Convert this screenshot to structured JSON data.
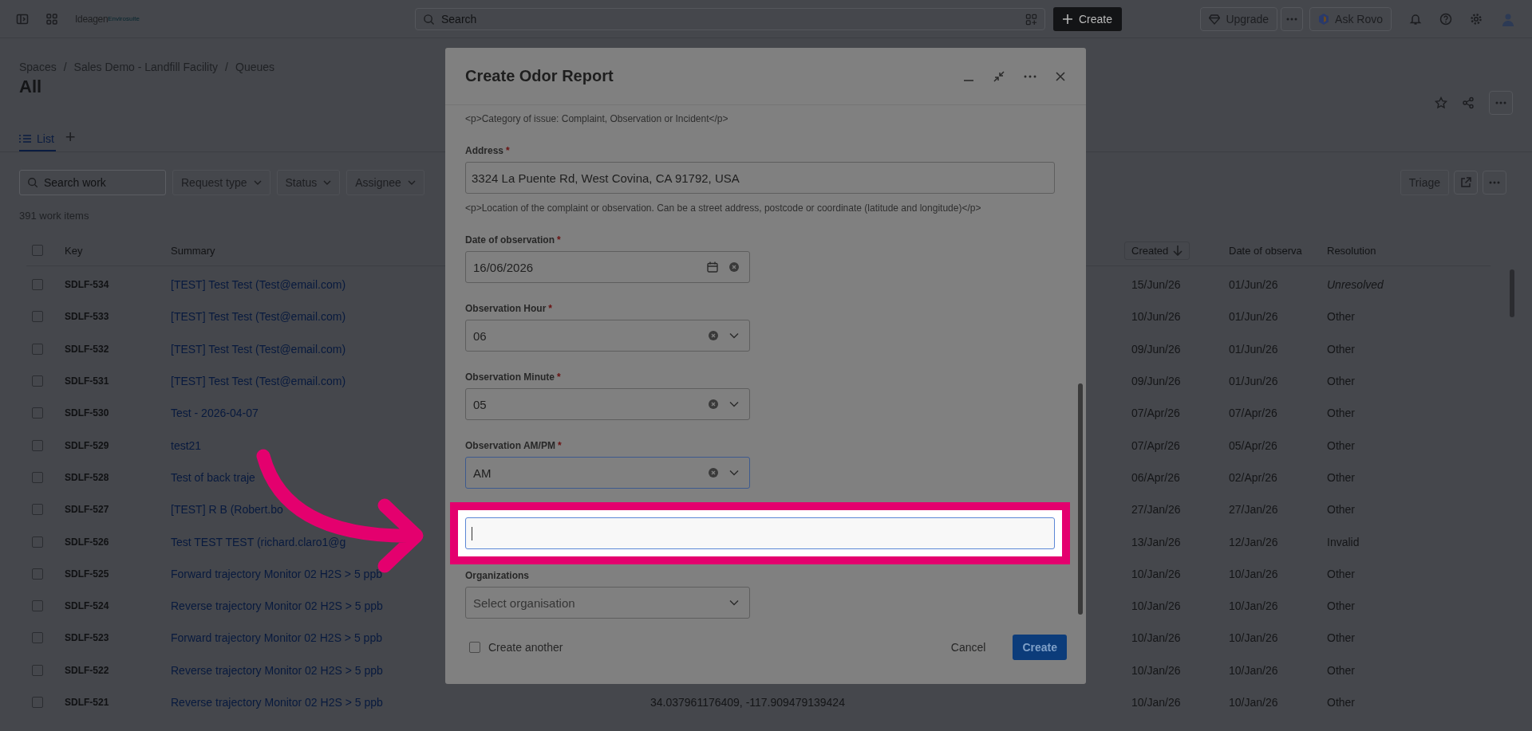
{
  "top_bar": {
    "logo": {
      "name": "Ideagen",
      "sub": "Envirosuite"
    },
    "search": {
      "placeholder": "Search"
    },
    "create_label": "Create",
    "upgrade_label": "Upgrade",
    "rovo_label": "Ask Rovo"
  },
  "breadcrumbs": [
    "Spaces",
    "Sales Demo - Landfill Facility",
    "Queues"
  ],
  "breadcrumb_separator": "/",
  "page_title": "All",
  "tabs": [
    {
      "label": "List",
      "selected": true
    }
  ],
  "add_tab": "+",
  "filters": {
    "search": {
      "placeholder": "Search work"
    },
    "dropdowns": [
      "Request type",
      "Status",
      "Assignee"
    ]
  },
  "actions": {
    "triage": "Triage"
  },
  "count": "391 work items",
  "table": {
    "columns": [
      {
        "label": "Key",
        "sorted": false
      },
      {
        "label": "Summary",
        "sorted": false
      },
      {
        "label": "Created",
        "sorted": true
      },
      {
        "label": "Date of observa",
        "sorted": false
      },
      {
        "label": "Resolution",
        "sorted": false
      }
    ],
    "all_checked": false,
    "rows": [
      {
        "checked": false,
        "key": "SDLF-534",
        "summary": "[TEST] Test Test (Test@email.com)",
        "created": "15/Jun/26",
        "observed": "01/Jun/26",
        "resolution": "Unresolved",
        "resolved": false
      },
      {
        "checked": false,
        "key": "SDLF-533",
        "summary": "[TEST] Test Test (Test@email.com)",
        "created": "10/Jun/26",
        "observed": "01/Jun/26",
        "resolution": "Other",
        "resolved": true
      },
      {
        "checked": false,
        "key": "SDLF-532",
        "summary": "[TEST] Test Test (Test@email.com)",
        "created": "09/Jun/26",
        "observed": "01/Jun/26",
        "resolution": "Other",
        "resolved": true
      },
      {
        "checked": false,
        "key": "SDLF-531",
        "summary": "[TEST] Test Test (Test@email.com)",
        "created": "09/Jun/26",
        "observed": "01/Jun/26",
        "resolution": "Other",
        "resolved": true
      },
      {
        "checked": false,
        "key": "SDLF-530",
        "summary": "Test - 2026-04-07",
        "created": "07/Apr/26",
        "observed": "07/Apr/26",
        "resolution": "Other",
        "resolved": true
      },
      {
        "checked": false,
        "key": "SDLF-529",
        "summary": "test21",
        "created": "07/Apr/26",
        "observed": "05/Apr/26",
        "resolution": "Other",
        "resolved": true
      },
      {
        "checked": false,
        "key": "SDLF-528",
        "summary": "Test of back traje",
        "created": "06/Apr/26",
        "observed": "02/Apr/26",
        "resolution": "Other",
        "resolved": true
      },
      {
        "checked": false,
        "key": "SDLF-527",
        "summary": "[TEST] R B (Robert.bo",
        "created": "27/Jan/26",
        "observed": "27/Jan/26",
        "resolution": "Other",
        "resolved": true
      },
      {
        "checked": false,
        "key": "SDLF-526",
        "summary": "Test TEST TEST (richard.claro1@g",
        "created": "13/Jan/26",
        "observed": "12/Jan/26",
        "resolution": "Invalid",
        "resolved": true
      },
      {
        "checked": false,
        "key": "SDLF-525",
        "summary": "Forward trajectory Monitor 02 H2S > 5 ppb",
        "created": "10/Jan/26",
        "observed": "10/Jan/26",
        "resolution": "Other",
        "resolved": true
      },
      {
        "checked": false,
        "key": "SDLF-524",
        "summary": "Reverse trajectory Monitor 02 H2S > 5 ppb",
        "created": "10/Jan/26",
        "observed": "10/Jan/26",
        "resolution": "Other",
        "resolved": true
      },
      {
        "checked": false,
        "key": "SDLF-523",
        "summary": "Forward trajectory Monitor 02 H2S > 5 ppb",
        "created": "10/Jan/26",
        "observed": "10/Jan/26",
        "resolution": "Other",
        "resolved": true
      },
      {
        "checked": false,
        "key": "SDLF-522",
        "summary": "Reverse trajectory Monitor 02 H2S > 5 ppb",
        "created": "10/Jan/26",
        "observed": "10/Jan/26",
        "resolution": "Other",
        "resolved": true
      },
      {
        "checked": false,
        "key": "SDLF-521",
        "summary": "Reverse trajectory Monitor 02 H2S > 5 ppb",
        "location": "34.037961176409, -117.909479139424",
        "created": "10/Jan/26",
        "observed": "10/Jan/26",
        "resolution": "Other",
        "resolved": true
      }
    ]
  },
  "modal": {
    "title": "Create Odor Report",
    "top_help": "<p>Category of issue: Complaint, Observation or Incident</p>",
    "fields": [
      {
        "kind": "text",
        "label": "Address",
        "required_mark": "*",
        "value": "3324 La Puente Rd, West Covina, CA 91792, USA",
        "help": "<p>Location of the complaint or observation. Can be a street address, postcode or coordinate (latitude and longitude)</p>",
        "focused": false,
        "highlighted": false
      },
      {
        "kind": "date",
        "label": "Date of observation",
        "required_mark": "*",
        "value": "16/06/2026",
        "focused": false,
        "highlighted": false
      },
      {
        "kind": "select",
        "label": "Observation Hour",
        "required_mark": "*",
        "value": "06",
        "focused": false,
        "highlighted": false
      },
      {
        "kind": "select",
        "label": "Observation Minute",
        "required_mark": "*",
        "value": "05",
        "focused": false,
        "highlighted": false
      },
      {
        "kind": "select",
        "label": "Observation AM/PM",
        "required_mark": "*",
        "value": "AM",
        "focused": true,
        "highlighted": false
      },
      {
        "kind": "text",
        "focused": true,
        "highlighted": true
      },
      {
        "kind": "select",
        "label": "Organizations",
        "placeholder": "Select organisation",
        "focused": false,
        "highlighted": false
      }
    ],
    "create_another": {
      "label": "Create another",
      "checked": false
    },
    "buttons": [
      {
        "label": "Cancel",
        "kind": "subtle"
      },
      {
        "label": "Create",
        "kind": "primary"
      }
    ]
  }
}
